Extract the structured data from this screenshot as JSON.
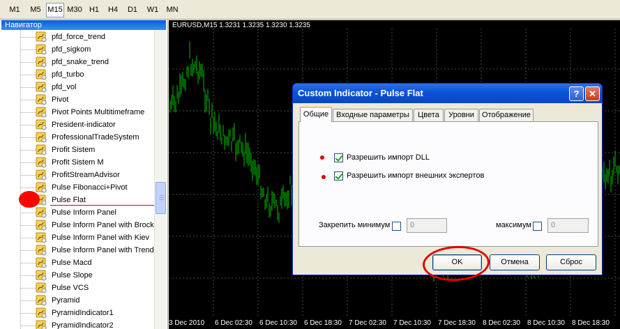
{
  "toolbar": {
    "timeframes": [
      "M1",
      "M5",
      "M15",
      "M30",
      "H1",
      "H4",
      "D1",
      "W1",
      "MN"
    ],
    "active": "M15"
  },
  "navigator": {
    "title": "Навигатор",
    "items": [
      "pfd_force_trend",
      "pfd_sigkom",
      "pfd_snake_trend",
      "pfd_turbo",
      "pfd_vol",
      "Pivot",
      "Pivot Points Multitimeframe",
      "President-indicator",
      "ProfessionalTradeSystem",
      "Profit Sistem",
      "Profit Sistem M",
      "ProfitStreamAdvisor",
      "Pulse Fibonacci+Pivot",
      "Pulse Flat",
      "Pulse Inform Panel",
      "Pulse Inform Panel with Brocke",
      "Pulse Inform Panel with Kiev",
      "Pulse Inform Panel with Trendl",
      "Pulse Macd",
      "Pulse Slope",
      "Pulse VCS",
      "Pyramid",
      "PyramidIndicator1",
      "PyramidIndicator2"
    ],
    "selected_index": 13,
    "scroll_position": 0.57
  },
  "chart": {
    "title": "EURUSD,M15  1.3231 1.3235 1.3230 1.3235",
    "x_labels": [
      "3 Dec 2010",
      "6 Dec 02:30",
      "6 Dec 10:30",
      "6 Dec 18:30",
      "7 Dec 02:30",
      "7 Dec 10:30",
      "7 Dec 18:30",
      "8 Dec 02:30",
      "8 Dec 10:30",
      "8 Dec 18:30"
    ],
    "colors": {
      "background": "#000000",
      "candles": "#00C000",
      "grid": "#4A4A4A"
    }
  },
  "dialog": {
    "title": "Custom Indicator - Pulse Flat",
    "help_glyph": "?",
    "close_glyph": "✕",
    "tabs": [
      "Общие",
      "Входные параметры",
      "Цвета",
      "Уровни",
      "Отображение"
    ],
    "active_tab": "Общие",
    "allow_dll": {
      "label": "Разрешить импорт DLL",
      "checked": true
    },
    "allow_experts": {
      "label": "Разрешить импорт внешних экспертов",
      "checked": true
    },
    "fix_min": {
      "label": "Закрепить минимум",
      "checked": false,
      "value": "0"
    },
    "fix_max": {
      "label": "максимум",
      "checked": false,
      "value": "0"
    },
    "buttons": {
      "ok": "OK",
      "cancel": "Отмена",
      "reset": "Сброс"
    }
  }
}
